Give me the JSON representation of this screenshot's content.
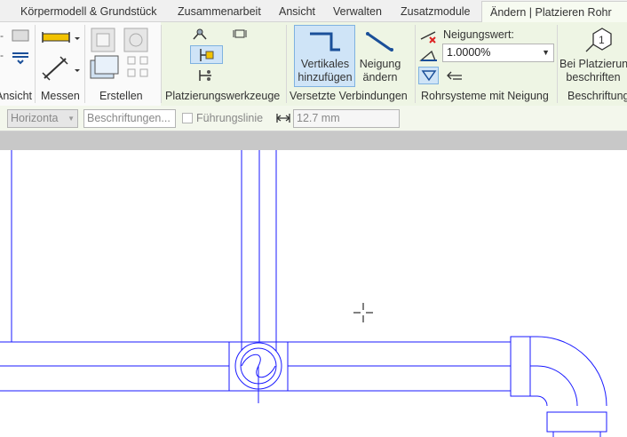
{
  "tabs": [
    {
      "label": "Körpermodell & Grundstück"
    },
    {
      "label": "Zusammenarbeit"
    },
    {
      "label": "Ansicht"
    },
    {
      "label": "Verwalten"
    },
    {
      "label": "Zusatzmodule"
    },
    {
      "label": "Ändern | Platzieren Rohr"
    }
  ],
  "panels": {
    "ansicht": "Ansicht",
    "messen": "Messen",
    "erstellen": "Erstellen",
    "platzierung": "Platzierungswerkzeuge",
    "versetzte": "Versetzte Verbindungen",
    "rohrsysteme": "Rohrsysteme mit Neigung",
    "beschriftung": "Beschriftung"
  },
  "buttons": {
    "vertikales_line1": "Vertikales",
    "vertikales_line2": "hinzufügen",
    "neigung_line1": "Neigung",
    "neigung_line2": "ändern",
    "beschriften_line1": "Bei Platzierung",
    "beschriften_line2": "beschriften"
  },
  "slope": {
    "label": "Neigungswert:",
    "value": "1.0000%"
  },
  "options": {
    "orientation": "Horizonta",
    "tag_placeholder": "Beschriftungen...",
    "leader_label": "Führungslinie",
    "leader_length": "12.7 mm"
  },
  "colors": {
    "pipe_line": "#1a1aff",
    "active_highlight": "#cfe4f7",
    "context_tab_bg": "#eef5e4"
  }
}
